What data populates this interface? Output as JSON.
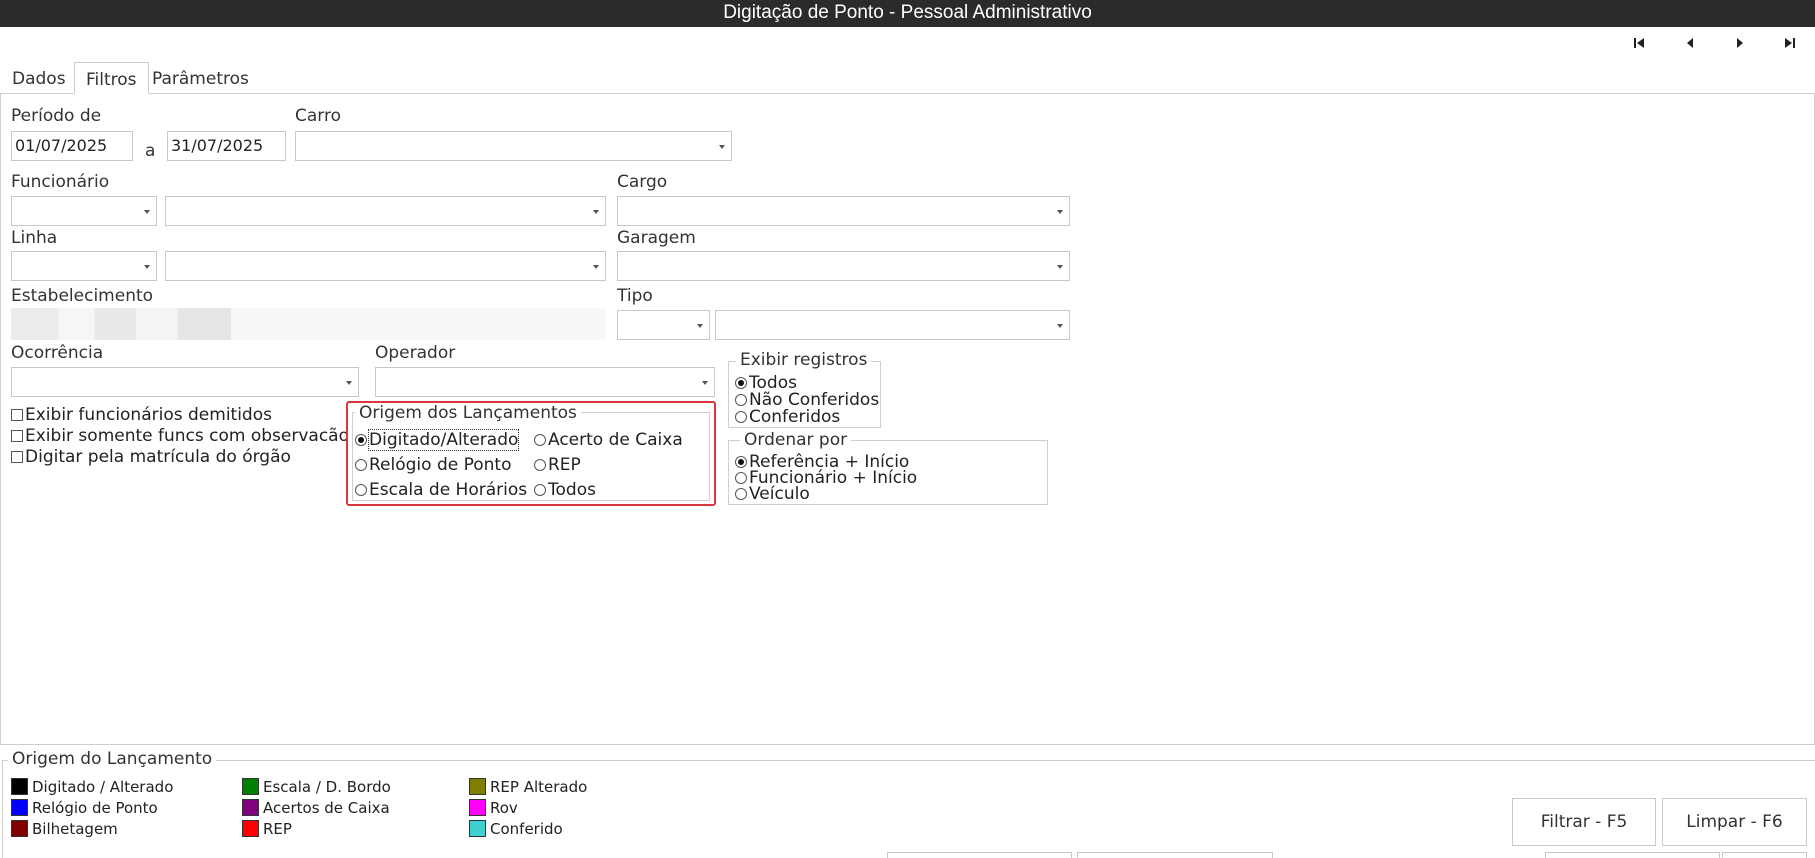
{
  "window": {
    "title": "Digitação de Ponto - Pessoal Administrativo"
  },
  "navigation": {
    "first": "first-record-icon",
    "prev": "previous-record-icon",
    "next": "next-record-icon",
    "last": "last-record-icon"
  },
  "tabs": [
    {
      "label": "Dados",
      "active": false
    },
    {
      "label": "Filtros",
      "active": true
    },
    {
      "label": "Parâmetros",
      "active": false
    }
  ],
  "filters": {
    "periodo_label": "Período de",
    "periodo_de": "01/07/2025",
    "periodo_sep": "a",
    "periodo_ate": "31/07/2025",
    "carro_label": "Carro",
    "funcionario_label": "Funcionário",
    "cargo_label": "Cargo",
    "linha_label": "Linha",
    "garagem_label": "Garagem",
    "estabelecimento_label": "Estabelecimento",
    "tipo_label": "Tipo",
    "ocorrencia_label": "Ocorrência",
    "operador_label": "Operador"
  },
  "checkboxes": [
    {
      "label": "Exibir funcionários demitidos",
      "checked": false
    },
    {
      "label": "Exibir somente funcs com observacão",
      "checked": false
    },
    {
      "label": "Digitar pela matrícula do órgão",
      "checked": false
    }
  ],
  "origem": {
    "title": "Origem dos Lançamentos",
    "options": [
      {
        "label": "Digitado/Alterado",
        "selected": true
      },
      {
        "label": "Relógio de Ponto",
        "selected": false
      },
      {
        "label": "Escala de Horários",
        "selected": false
      },
      {
        "label": "Acerto de Caixa",
        "selected": false
      },
      {
        "label": "REP",
        "selected": false
      },
      {
        "label": "Todos",
        "selected": false
      }
    ]
  },
  "exibir": {
    "title": "Exibir registros",
    "options": [
      {
        "label": "Todos",
        "selected": true
      },
      {
        "label": "Não Conferidos",
        "selected": false
      },
      {
        "label": "Conferidos",
        "selected": false
      }
    ]
  },
  "ordenar": {
    "title": "Ordenar por",
    "options": [
      {
        "label": "Referência + Início",
        "selected": true
      },
      {
        "label": "Funcionário + Início",
        "selected": false
      },
      {
        "label": "Veículo",
        "selected": false
      }
    ]
  },
  "legend": {
    "title": "Origem do Lançamento",
    "items": [
      {
        "label": "Digitado / Alterado",
        "color": "#000000"
      },
      {
        "label": "Relógio de Ponto",
        "color": "#0000ff"
      },
      {
        "label": "Bilhetagem",
        "color": "#800000"
      },
      {
        "label": "Escala / D. Bordo",
        "color": "#008000"
      },
      {
        "label": "Acertos de Caixa",
        "color": "#800080"
      },
      {
        "label": "REP",
        "color": "#ff0000"
      },
      {
        "label": "REP Alterado",
        "color": "#808000"
      },
      {
        "label": "Rov",
        "color": "#ff00ff"
      },
      {
        "label": "Conferido",
        "color": "#40d0d0"
      }
    ]
  },
  "buttons": {
    "filtrar": "Filtrar - F5",
    "limpar": "Limpar - F6"
  }
}
